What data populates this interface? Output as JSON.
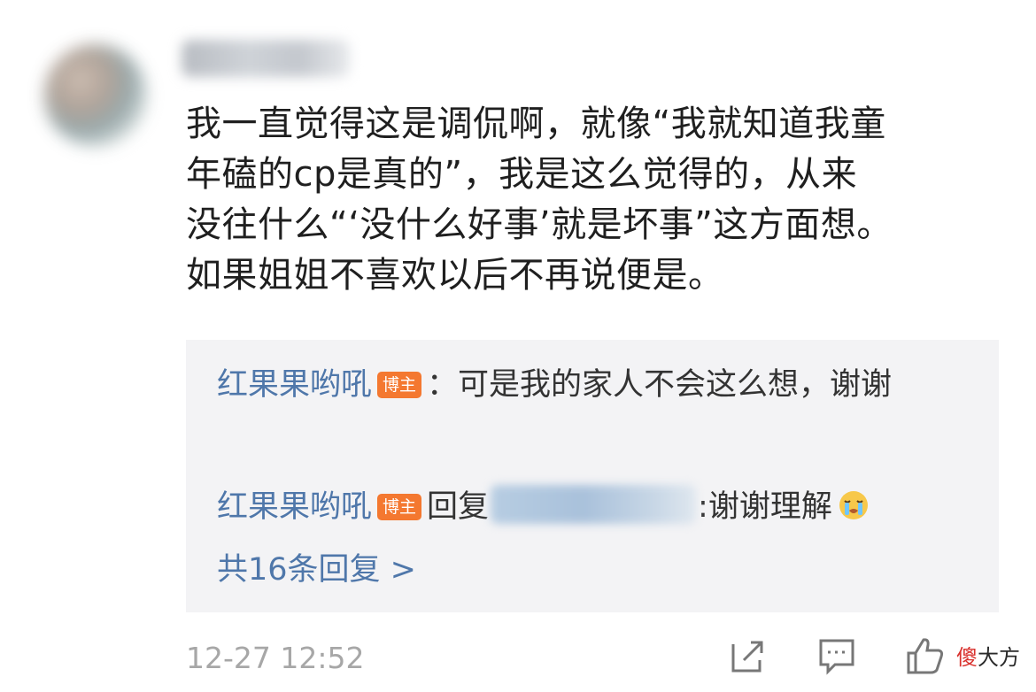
{
  "comment": {
    "text": "我一直觉得这是调侃啊，就像“我就知道我童\n年磕的cp是真的”，我是这么觉得的，从来\n没往什么“‘没什么好事’就是坏事”这方面想。\n如果姐姐不喜欢以后不再说便是。",
    "timestamp": "12-27 12:52"
  },
  "replies": [
    {
      "author": "红果果哟吼",
      "badge": "博主",
      "text": "：可是我的家人不会这么想，谢谢"
    },
    {
      "author": "红果果哟吼",
      "badge": "博主",
      "reply_prefix": "回复",
      "text": ":谢谢理解",
      "emoji": "crying-face"
    }
  ],
  "total_replies_link": "共16条回复 >",
  "actions": {
    "share_icon": "share-icon",
    "comment_icon": "comment-icon",
    "like_icon": "thumbs-up-icon"
  },
  "watermark": {
    "red_part": "傻",
    "dark_part": "大方"
  },
  "colors": {
    "author": "#4f77aa",
    "badge": "#f47830",
    "reply_bg": "#f3f3f5",
    "timestamp": "#a7a7a7"
  }
}
